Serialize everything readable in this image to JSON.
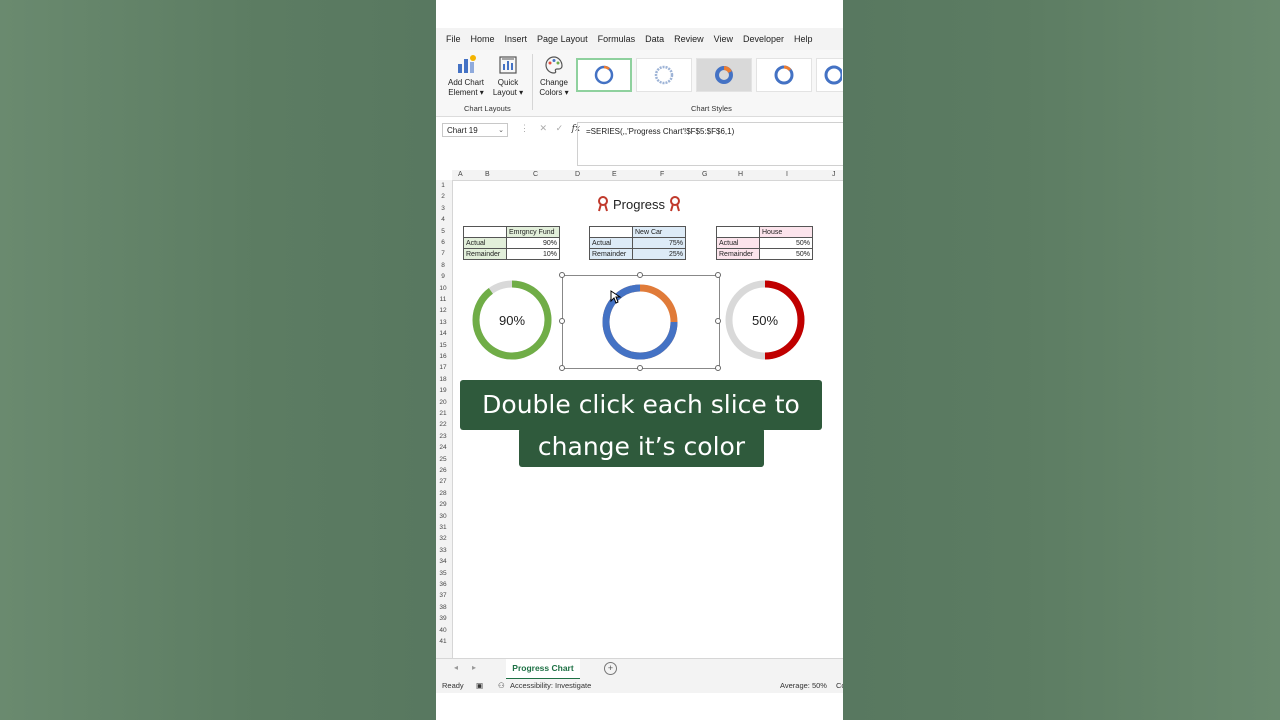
{
  "menu": [
    "File",
    "Home",
    "Insert",
    "Page Layout",
    "Formulas",
    "Data",
    "Review",
    "View",
    "Developer",
    "Help"
  ],
  "ribbon": {
    "add_chart_element": [
      "Add Chart",
      "Element ▾"
    ],
    "quick_layout": [
      "Quick",
      "Layout ▾"
    ],
    "change_colors": [
      "Change",
      "Colors ▾"
    ],
    "group_chart_layouts": "Chart Layouts",
    "group_chart_styles": "Chart Styles"
  },
  "formula_bar": {
    "name_box": "Chart 19",
    "fx": "fx",
    "formula": "=SERIES(,,'Progress Chart'!$F$5:$F$6,1)"
  },
  "columns": [
    "A",
    "B",
    "C",
    "D",
    "E",
    "F",
    "G",
    "H",
    "I",
    "J"
  ],
  "rows": [
    "1",
    "2",
    "3",
    "4",
    "5",
    "6",
    "7",
    "8",
    "9",
    "10",
    "11",
    "12",
    "13",
    "14",
    "15",
    "16",
    "17",
    "18",
    "19",
    "20",
    "21",
    "22",
    "23",
    "24",
    "25",
    "26",
    "27",
    "28",
    "29",
    "30",
    "31",
    "32",
    "33",
    "34",
    "35",
    "36",
    "37",
    "38",
    "39",
    "40",
    "41"
  ],
  "sheet_title": "Progress",
  "tables": [
    {
      "header": "Emrgncy Fund",
      "rows": [
        [
          "Actual",
          "90%"
        ],
        [
          "Remainder",
          "10%"
        ]
      ],
      "color": "#e2efda"
    },
    {
      "header": "New Car",
      "rows": [
        [
          "Actual",
          "75%"
        ],
        [
          "Remainder",
          "25%"
        ]
      ],
      "color": "#ddebf7"
    },
    {
      "header": "House",
      "rows": [
        [
          "Actual",
          "50%"
        ],
        [
          "Remainder",
          "50%"
        ]
      ],
      "color": "#fce4ec"
    }
  ],
  "donuts": [
    {
      "label": "90%",
      "value": 0.9,
      "color": "#70ad47",
      "rest": "#d9d9d9"
    },
    {
      "label": "",
      "value": 0.75,
      "color": "#4472c4",
      "rest": "#e07b39"
    },
    {
      "label": "50%",
      "value": 0.5,
      "color": "#c00000",
      "rest": "#d9d9d9"
    }
  ],
  "caption": {
    "line1": "Double click each slice to",
    "line2": "change it’s color"
  },
  "sheet_tab": "Progress Chart",
  "status": {
    "ready": "Ready",
    "accessibility": "Accessibility: Investigate",
    "average": "Average: 50%",
    "cut": "Co"
  }
}
